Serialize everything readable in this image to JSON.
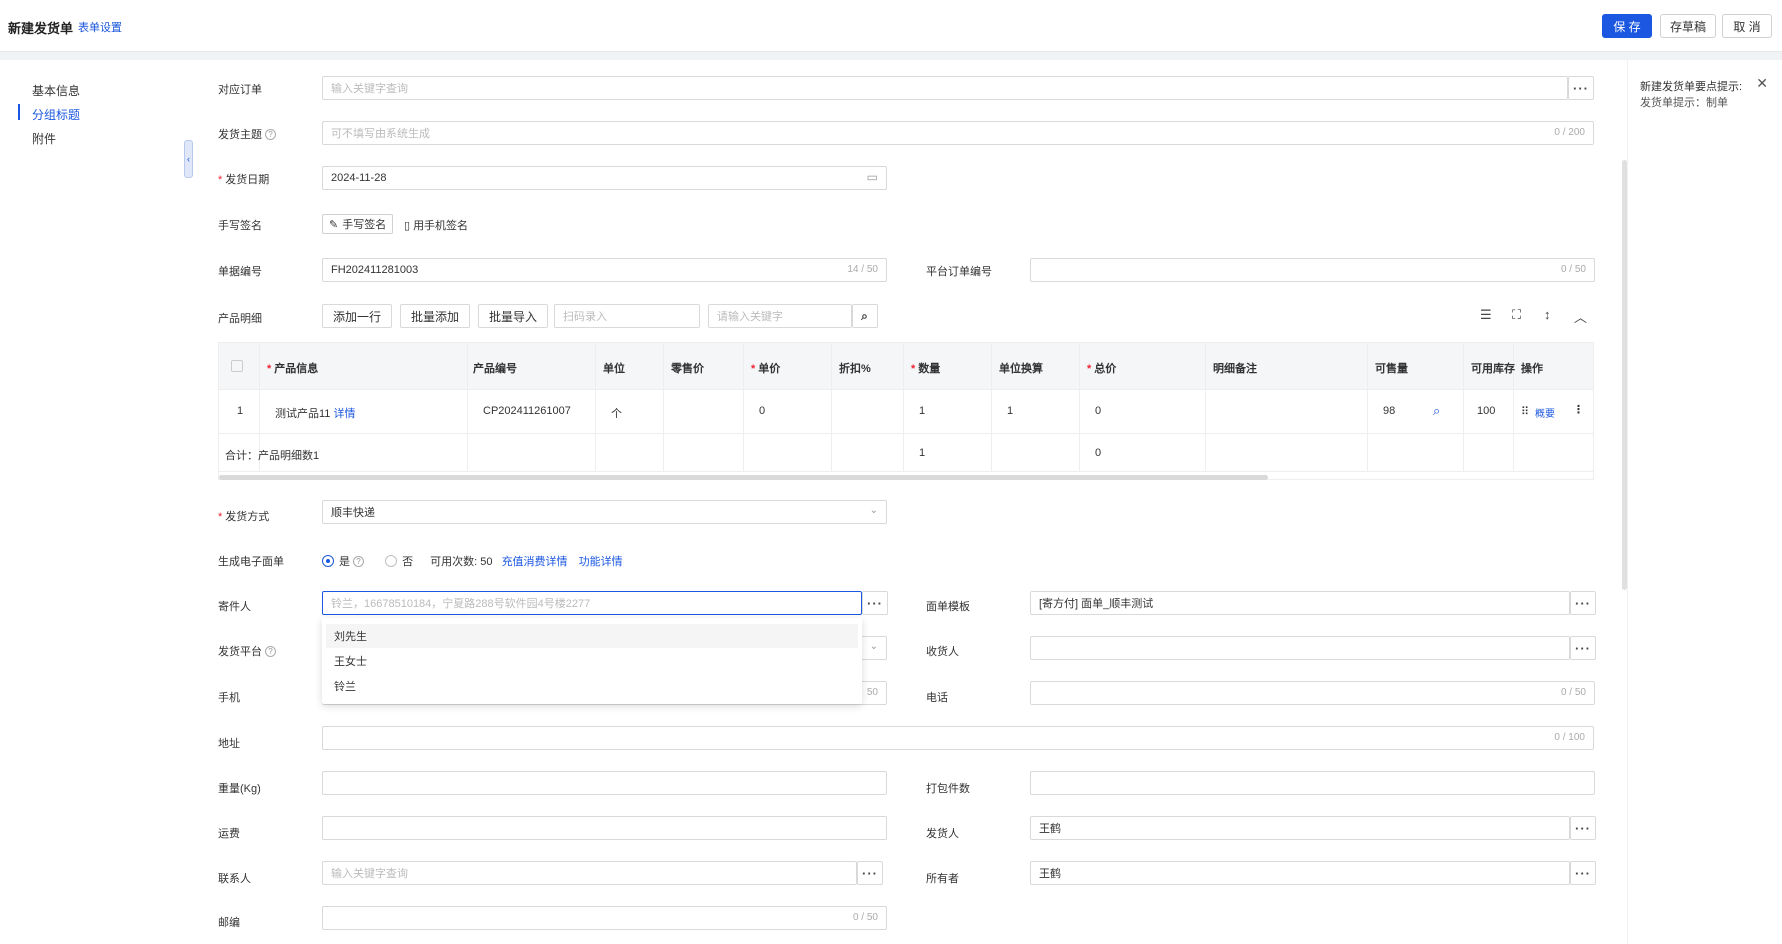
{
  "header": {
    "title": "新建发货单",
    "form_settings": "表单设置",
    "save": "保 存",
    "draft": "存草稿",
    "cancel": "取 消"
  },
  "nav": {
    "items": [
      "基本信息",
      "分组标题",
      "附件"
    ]
  },
  "tips": {
    "title": "新建发货单要点提示:",
    "body": "发货单提示：制单"
  },
  "form": {
    "order": {
      "label": "对应订单",
      "placeholder": "输入关键字查询"
    },
    "subject": {
      "label": "发货主题",
      "placeholder": "可不填写由系统生成",
      "count": "0 / 200"
    },
    "date": {
      "label": "发货日期",
      "value": "2024-11-28"
    },
    "signature": {
      "label": "手写签名",
      "btn_handwrite": "手写签名",
      "btn_mobile": "用手机签名"
    },
    "doc_no": {
      "label": "单据编号",
      "value": "FH202411281003",
      "count": "14 / 50"
    },
    "platform_no": {
      "label": "平台订单编号",
      "count": "0 / 50"
    },
    "products": {
      "label": "产品明细",
      "add_row": "添加一行",
      "batch_add": "批量添加",
      "batch_import": "批量导入",
      "scan_placeholder": "扫码录入",
      "search_placeholder": "请输入关键字"
    },
    "ship_method": {
      "label": "发货方式",
      "value": "顺丰快递"
    },
    "e_waybill": {
      "label": "生成电子面单",
      "yes": "是",
      "no": "否",
      "available": "可用次数:",
      "available_count": "50",
      "recharge": "充值消费详情",
      "features": "功能详情"
    },
    "sender": {
      "label": "寄件人",
      "placeholder": "铃兰，16678510184，宁夏路288号软件园4号楼2277"
    },
    "template": {
      "label": "面单模板",
      "value": "[寄方付] 面单_顺丰测试"
    },
    "platform": {
      "label": "发货平台"
    },
    "receiver": {
      "label": "收货人"
    },
    "mobile": {
      "label": "手机",
      "count": "50"
    },
    "phone": {
      "label": "电话",
      "count": "0 / 50"
    },
    "address": {
      "label": "地址",
      "count": "0 / 100"
    },
    "weight": {
      "label": "重量(Kg)"
    },
    "packages": {
      "label": "打包件数"
    },
    "freight": {
      "label": "运费"
    },
    "shipper": {
      "label": "发货人",
      "value": "王鹤"
    },
    "contact": {
      "label": "联系人",
      "placeholder": "输入关键字查询"
    },
    "owner": {
      "label": "所有者",
      "value": "王鹤"
    },
    "postcode": {
      "label": "邮编",
      "count": "0 / 50"
    }
  },
  "dropdown": {
    "options": [
      "刘先生",
      "王女士",
      "铃兰"
    ]
  },
  "table": {
    "headers": [
      "产品信息",
      "产品编号",
      "单位",
      "零售价",
      "单价",
      "折扣%",
      "数量",
      "单位换算",
      "总价",
      "明细备注",
      "可售量",
      "可用库存",
      "操作"
    ],
    "row": {
      "index": "1",
      "product": "测试产品11",
      "detail": "详情",
      "code": "CP202411261007",
      "unit": "个",
      "price": "0",
      "qty": "1",
      "conversion": "1",
      "total": "0",
      "sellable": "98",
      "stock": "100",
      "action": "概要"
    },
    "summary": {
      "label": "合计：产品明细数1",
      "qty": "1",
      "total": "0"
    }
  },
  "colors": {
    "accent": "#1b57e0",
    "required": "#e23"
  }
}
